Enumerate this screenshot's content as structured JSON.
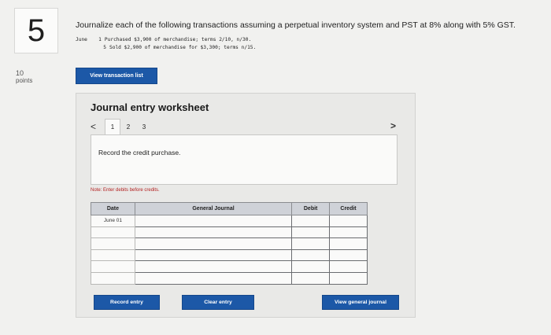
{
  "question": {
    "number": "5",
    "points_value": "10",
    "points_label": "points",
    "instruction": "Journalize each of the following transactions assuming a perpetual inventory system and PST at 8% along with 5% GST.",
    "transactions": [
      {
        "month": "June",
        "day": "1",
        "text": "Purchased $3,900 of merchandise; terms 2/10, n/30."
      },
      {
        "month": "",
        "day": "5",
        "text": "Sold $2,900 of merchandise for $3,300; terms n/15."
      }
    ]
  },
  "view_transaction_button": "View transaction list",
  "worksheet": {
    "title": "Journal entry worksheet",
    "prev_icon": "<",
    "next_icon": ">",
    "tabs": [
      "1",
      "2",
      "3"
    ],
    "active_tab": "1",
    "description": "Record the credit purchase.",
    "note_prefix": "Note:",
    "note_text": " Enter debits before credits.",
    "table": {
      "headers": {
        "date": "Date",
        "account": "General Journal",
        "debit": "Debit",
        "credit": "Credit"
      },
      "rows": [
        {
          "date": "June 01",
          "account": "",
          "debit": "",
          "credit": ""
        },
        {
          "date": "",
          "account": "",
          "debit": "",
          "credit": ""
        },
        {
          "date": "",
          "account": "",
          "debit": "",
          "credit": ""
        },
        {
          "date": "",
          "account": "",
          "debit": "",
          "credit": ""
        },
        {
          "date": "",
          "account": "",
          "debit": "",
          "credit": ""
        },
        {
          "date": "",
          "account": "",
          "debit": "",
          "credit": ""
        }
      ]
    },
    "buttons": {
      "record": "Record entry",
      "clear": "Clear entry",
      "view_general": "View general journal"
    }
  },
  "colors": {
    "primary_button": "#1c58a7",
    "table_header": "#cfd2d8",
    "note_red": "#b32020"
  }
}
